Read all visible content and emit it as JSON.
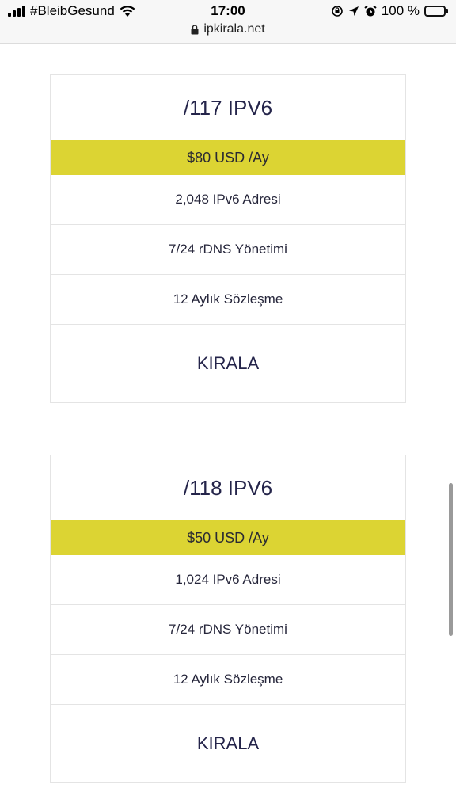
{
  "status_bar": {
    "carrier": "#BleibGesund",
    "time": "17:00",
    "battery": "100 %"
  },
  "browser": {
    "url": "ipkirala.net"
  },
  "plans": [
    {
      "title": "/117 IPV6",
      "price": "$80 USD /Ay",
      "features": [
        "2,048 IPv6 Adresi",
        "7/24 rDNS Yönetimi",
        "12 Aylık Sözleşme"
      ],
      "cta": "KIRALA"
    },
    {
      "title": "/118 IPV6",
      "price": "$50 USD /Ay",
      "features": [
        "1,024 IPv6 Adresi",
        "7/24 rDNS Yönetimi",
        "12 Aylık Sözleşme"
      ],
      "cta": "KIRALA"
    }
  ],
  "colors": {
    "price_band": "#dcd433",
    "text": "#24244a"
  },
  "icons": [
    "cellular-signal-icon",
    "wifi-icon",
    "lock-icon",
    "rotation-lock-icon",
    "location-arrow-icon",
    "alarm-icon",
    "battery-charging-icon"
  ]
}
